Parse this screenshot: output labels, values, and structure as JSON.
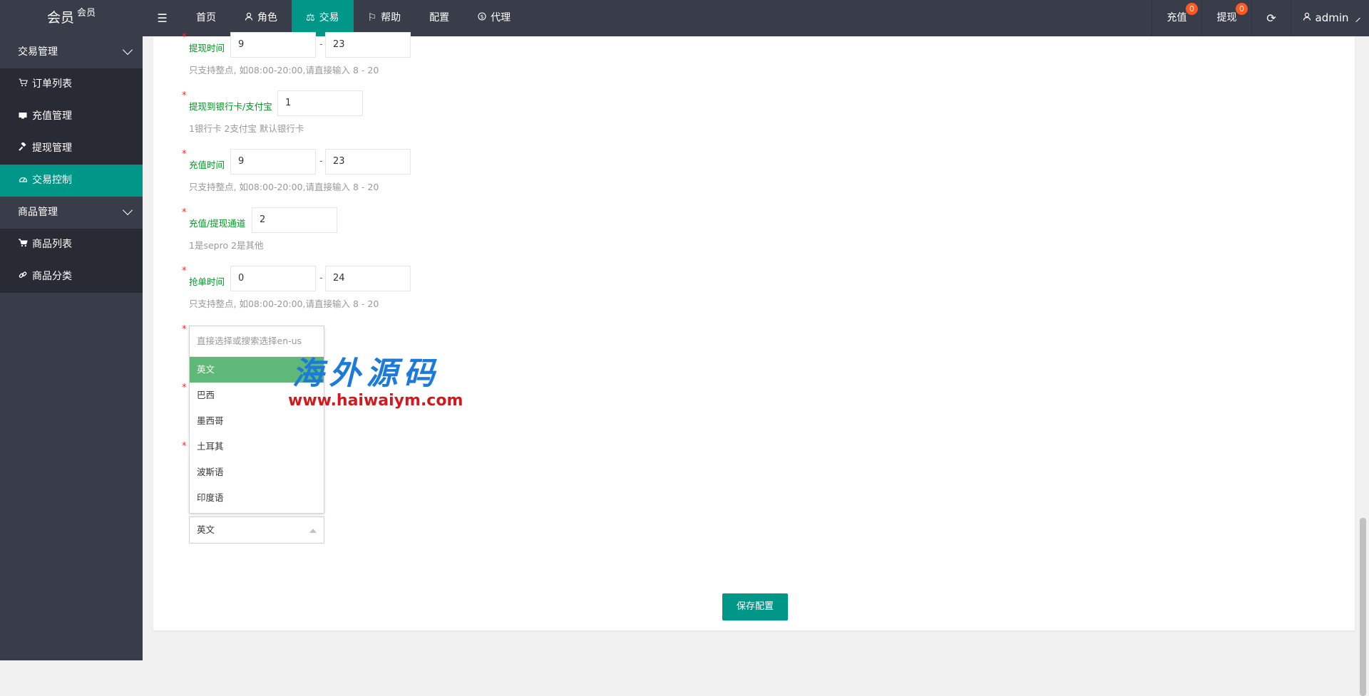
{
  "header": {
    "logo_main": "会员",
    "logo_sup": "会员",
    "nav": [
      {
        "label": "首页",
        "icon": ""
      },
      {
        "label": "角色",
        "icon": "user-icon"
      },
      {
        "label": "交易",
        "icon": "scale-icon"
      },
      {
        "label": "帮助",
        "icon": "flag-icon"
      },
      {
        "label": "配置",
        "icon": ""
      },
      {
        "label": "代理",
        "icon": "dollar-icon"
      }
    ],
    "right": {
      "recharge_label": "充值",
      "recharge_count": "0",
      "withdraw_label": "提现",
      "withdraw_count": "0",
      "user_label": "admin"
    }
  },
  "sidebar": {
    "groups": [
      {
        "label": "交易管理",
        "items": [
          {
            "label": "订单列表",
            "icon": "cart-icon"
          },
          {
            "label": "充值管理",
            "icon": "card-icon"
          },
          {
            "label": "提现管理",
            "icon": "gavel-icon"
          },
          {
            "label": "交易控制",
            "icon": "gauge-icon"
          }
        ]
      },
      {
        "label": "商品管理",
        "items": [
          {
            "label": "商品列表",
            "icon": "shopping-cart-icon"
          },
          {
            "label": "商品分类",
            "icon": "link-icon"
          }
        ]
      }
    ]
  },
  "form": {
    "withdraw_time": {
      "label": "提现时间",
      "from": "9",
      "to": "23",
      "hint": "只支持整点, 如08:00-20:00,请直接输入 8 - 20"
    },
    "withdraw_target": {
      "label": "提现到银行卡/支付宝",
      "value": "1",
      "hint": "1银行卡 2支付宝 默认银行卡"
    },
    "recharge_time": {
      "label": "充值时间",
      "from": "9",
      "to": "23",
      "hint": "只支持整点, 如08:00-20:00,请直接输入 8 - 20"
    },
    "channel": {
      "label": "充值/提现通道",
      "value": "2",
      "hint": "1是sepro 2是其他"
    },
    "grab_time": {
      "label": "抢单时间",
      "from": "0",
      "to": "24",
      "hint": "只支持整点, 如08:00-20:00,请直接输入 8 - 20"
    },
    "separator": "-",
    "language": {
      "search_placeholder": "直接选择或搜索选择en-us",
      "options": [
        "英文",
        "巴西",
        "墨西哥",
        "土耳其",
        "波斯语",
        "印度语"
      ],
      "selected": "英文"
    },
    "save_label": "保存配置"
  },
  "watermark": {
    "title": "海外源码",
    "url": "www.haiwaiym.com"
  }
}
